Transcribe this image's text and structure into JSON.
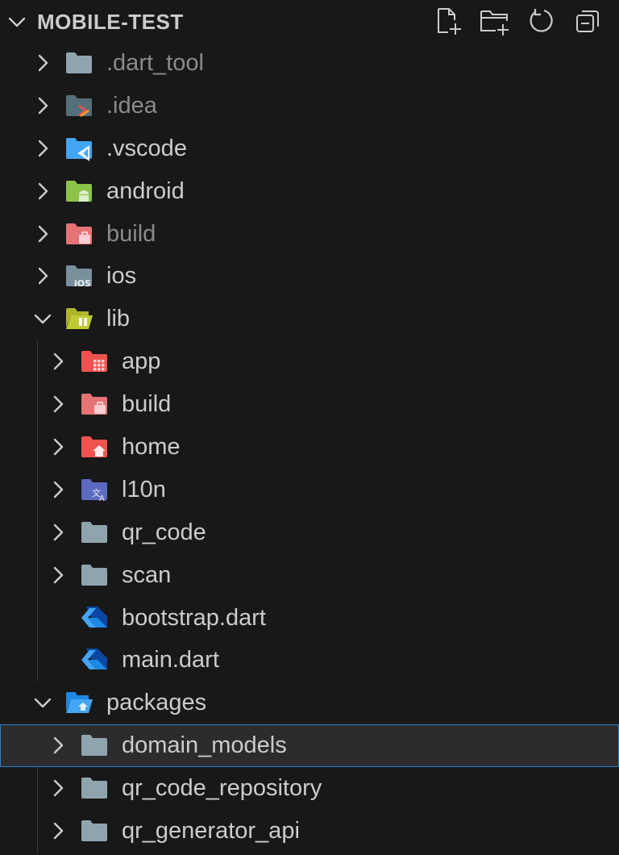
{
  "explorer": {
    "title": "MOBILE-TEST",
    "actions": [
      {
        "name": "new-file-icon"
      },
      {
        "name": "new-folder-icon"
      },
      {
        "name": "refresh-icon"
      },
      {
        "name": "collapse-all-icon"
      }
    ]
  },
  "tree": [
    {
      "label": ".dart_tool",
      "twisty": "right",
      "icon": "folder-gray-icon",
      "dim": true
    },
    {
      "label": ".idea",
      "twisty": "right",
      "icon": "folder-idea-icon",
      "dim": true
    },
    {
      "label": ".vscode",
      "twisty": "right",
      "icon": "folder-vscode-icon"
    },
    {
      "label": "android",
      "twisty": "right",
      "icon": "folder-android-icon"
    },
    {
      "label": "build",
      "twisty": "right",
      "icon": "folder-build-icon",
      "dim": true
    },
    {
      "label": "ios",
      "twisty": "right",
      "icon": "folder-ios-icon"
    },
    {
      "label": "lib",
      "twisty": "down",
      "icon": "folder-lib-open-icon"
    },
    {
      "label": "app",
      "twisty": "right",
      "icon": "folder-app-icon"
    },
    {
      "label": "build",
      "twisty": "right",
      "icon": "folder-build-icon"
    },
    {
      "label": "home",
      "twisty": "right",
      "icon": "folder-home-icon"
    },
    {
      "label": "l10n",
      "twisty": "right",
      "icon": "folder-i18n-icon"
    },
    {
      "label": "qr_code",
      "twisty": "right",
      "icon": "folder-gray-icon"
    },
    {
      "label": "scan",
      "twisty": "right",
      "icon": "folder-gray-icon"
    },
    {
      "label": "bootstrap.dart",
      "twisty": "none",
      "icon": "dart-file-icon"
    },
    {
      "label": "main.dart",
      "twisty": "none",
      "icon": "dart-file-icon"
    },
    {
      "label": "packages",
      "twisty": "down",
      "icon": "folder-packages-open-icon"
    },
    {
      "label": "domain_models",
      "twisty": "right",
      "icon": "folder-gray-icon",
      "selected": true
    },
    {
      "label": "qr_code_repository",
      "twisty": "right",
      "icon": "folder-gray-icon"
    },
    {
      "label": "qr_generator_api",
      "twisty": "right",
      "icon": "folder-gray-icon"
    }
  ],
  "colors": {
    "background": "#181818",
    "selection_border": "#2f7fd2",
    "selection_bg": "#2c2c2c"
  }
}
